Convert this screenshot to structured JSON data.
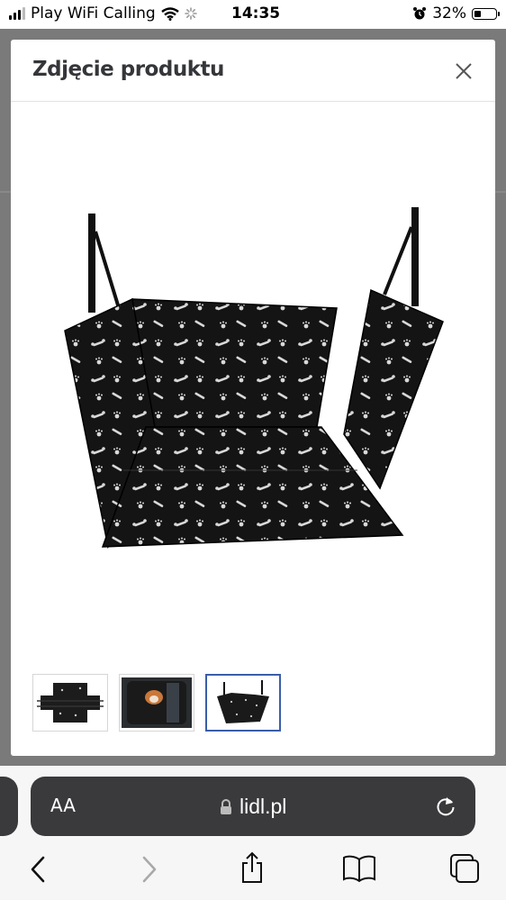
{
  "status_bar": {
    "carrier": "Play WiFi Calling",
    "time": "14:35",
    "battery": "32%",
    "battery_level": 0.32
  },
  "modal": {
    "title": "Zdjęcie produktu",
    "close_icon": "close-icon",
    "main_image": "dog-car-seat-cover-bone-paw-pattern",
    "thumbnails": [
      {
        "icon": "seat-cover-flat-thumbnail",
        "active": false
      },
      {
        "icon": "dog-in-car-thumbnail",
        "active": true
      },
      {
        "icon": "seat-cover-hanging-thumbnail",
        "active": true
      }
    ]
  },
  "browser": {
    "aa_label": "AA",
    "url": "lidl.pl",
    "icons": [
      "lock-icon",
      "reload-icon",
      "back-icon",
      "forward-icon",
      "share-icon",
      "bookmarks-icon",
      "tabs-icon"
    ]
  },
  "colors": {
    "accent": "#3a5ea8",
    "overlay": "#7a7a7a",
    "urlbar": "#3a3a3c",
    "title": "#35363a"
  }
}
